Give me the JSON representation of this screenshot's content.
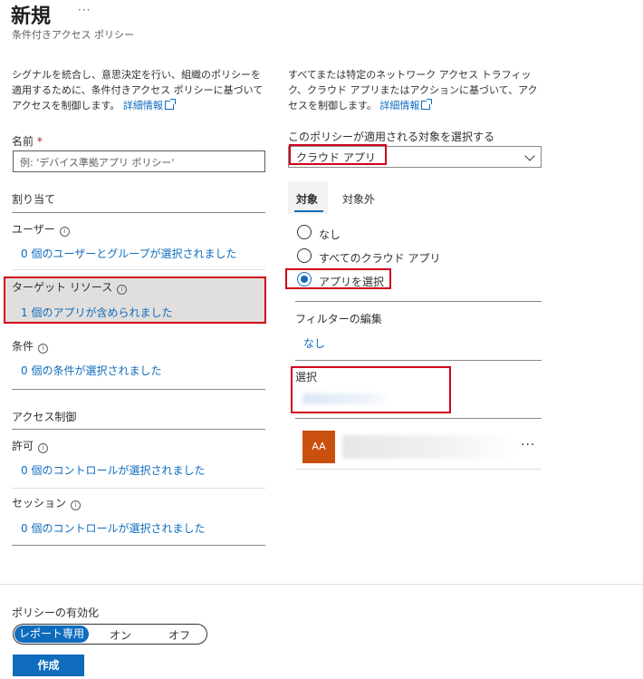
{
  "header": {
    "title": "新規",
    "more": "···",
    "subtitle": "条件付きアクセス ポリシー"
  },
  "left": {
    "description": "シグナルを統合し、意思決定を行い、組織のポリシーを適用するために、条件付きアクセス ポリシーに基づいてアクセスを制御します。",
    "learn_more": "詳細情報",
    "name_label": "名前",
    "required_mark": "*",
    "name_placeholder": "例: 'デバイス準拠アプリ ポリシー'",
    "assignments_heading": "割り当て",
    "users_label": "ユーザー",
    "users_value": "0 個のユーザーとグループが選択されました",
    "target_label": "ターゲット リソース",
    "target_value": "1 個のアプリが含められました",
    "conditions_label": "条件",
    "conditions_value": "0 個の条件が選択されました",
    "access_controls_heading": "アクセス制御",
    "grant_label": "許可",
    "grant_value": "0 個のコントロールが選択されました",
    "session_label": "セッション",
    "session_value": "0 個のコントロールが選択されました"
  },
  "right": {
    "description": "すべてまたは特定のネットワーク アクセス トラフィック、クラウド アプリまたはアクションに基づいて、アクセスを制御します。",
    "learn_more": "詳細情報",
    "select_label": "このポリシーが適用される対象を選択する",
    "select_value": "クラウド アプリ",
    "tabs": [
      {
        "label": "対象"
      },
      {
        "label": "対象外"
      }
    ],
    "radios": [
      {
        "label": "なし",
        "checked": false
      },
      {
        "label": "すべてのクラウド アプリ",
        "checked": false
      },
      {
        "label": "アプリを選択",
        "checked": true
      }
    ],
    "filter_label": "フィルターの編集",
    "filter_value": "なし",
    "select_section_label": "選択",
    "app_avatar": "AA",
    "app_more": "···"
  },
  "footer": {
    "enable_label": "ポリシーの有効化",
    "toggle_options": [
      "レポート専用",
      "オン",
      "オフ"
    ],
    "selected_option": "レポート専用",
    "create_button": "作成"
  },
  "colors": {
    "accent": "#0f6cbd",
    "highlight_border": "#d0021b",
    "avatar": "#ca5010"
  }
}
